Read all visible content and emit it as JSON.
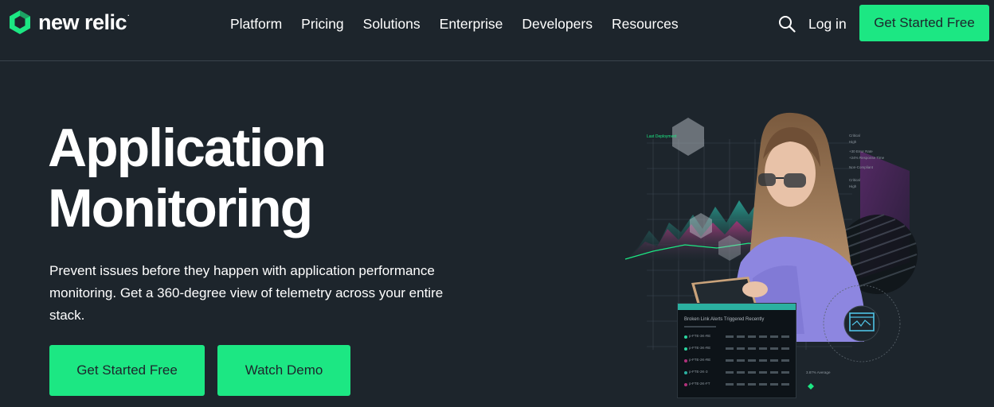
{
  "brand": {
    "name": "new relic",
    "reg": ".",
    "accent": "#1ce783",
    "background": "#1d252c"
  },
  "nav": {
    "items": [
      "Platform",
      "Pricing",
      "Solutions",
      "Enterprise",
      "Developers",
      "Resources"
    ]
  },
  "header": {
    "search_icon": "search-icon",
    "login": "Log in",
    "cta": "Get Started Free"
  },
  "hero": {
    "title_line1": "Application",
    "title_line2": "Monitoring",
    "description": "Prevent issues before they happen with application performance monitoring. Get a 360-degree view of telemetry across your entire stack.",
    "primary_button": "Get Started Free",
    "secondary_button": "Watch Demo"
  },
  "illustration": {
    "panel_title": "Broken Link Alerts Triggered Recently",
    "chart_label": "Last Deployment",
    "average_label": "3.87% Average",
    "panel_rows": [
      "p-FTE-3K-RE",
      "p-FTE-3K-RE",
      "p-FTE-2K-RE",
      "p-FTE-2K-3",
      "p-FTE-2K-FT"
    ],
    "side_labels": [
      "Critical",
      "High",
      "+30 Error Rate",
      "+24% Response Time",
      "Non-Compliant",
      "Critical",
      "High"
    ]
  }
}
